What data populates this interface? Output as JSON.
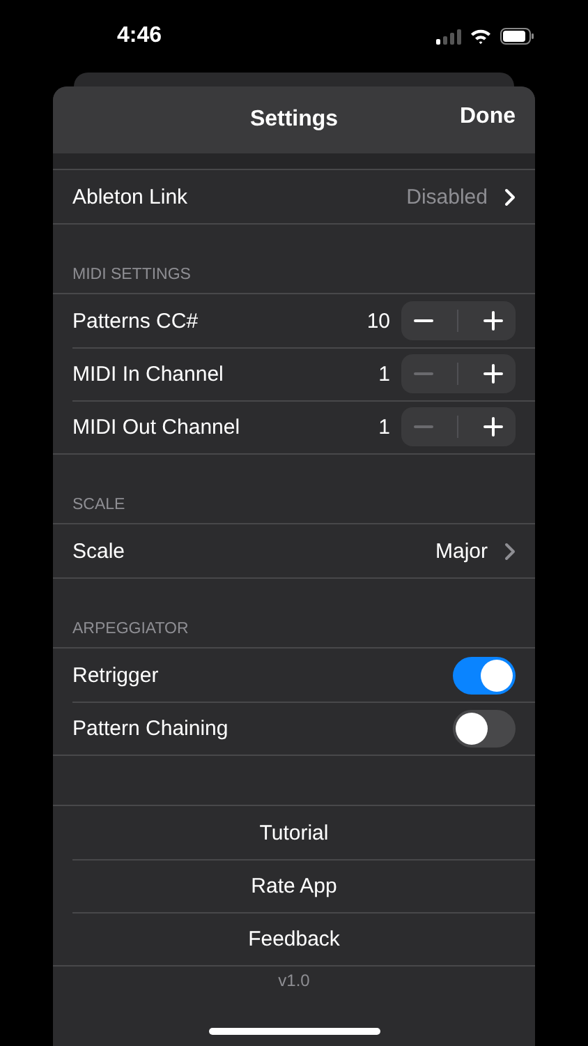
{
  "status_bar": {
    "time": "4:46"
  },
  "nav": {
    "title": "Settings",
    "done": "Done"
  },
  "sections": [
    {
      "rows": [
        {
          "kind": "disclosure",
          "label": "Ableton Link",
          "value": "Disabled"
        }
      ]
    },
    {
      "header": "MIDI SETTINGS",
      "rows": [
        {
          "kind": "stepper",
          "label": "Patterns CC#",
          "value": "10",
          "minus_disabled": false
        },
        {
          "kind": "stepper",
          "label": "MIDI In Channel",
          "value": "1",
          "minus_disabled": true
        },
        {
          "kind": "stepper",
          "label": "MIDI Out Channel",
          "value": "1",
          "minus_disabled": true
        }
      ]
    },
    {
      "header": "SCALE",
      "rows": [
        {
          "kind": "disclosure",
          "label": "Scale",
          "value": "Major"
        }
      ]
    },
    {
      "header": "ARPEGGIATOR",
      "rows": [
        {
          "kind": "toggle",
          "label": "Retrigger",
          "on": true
        },
        {
          "kind": "toggle",
          "label": "Pattern Chaining",
          "on": false
        }
      ]
    }
  ],
  "actions": [
    "Tutorial",
    "Rate App",
    "Feedback"
  ],
  "version": "v1.0"
}
